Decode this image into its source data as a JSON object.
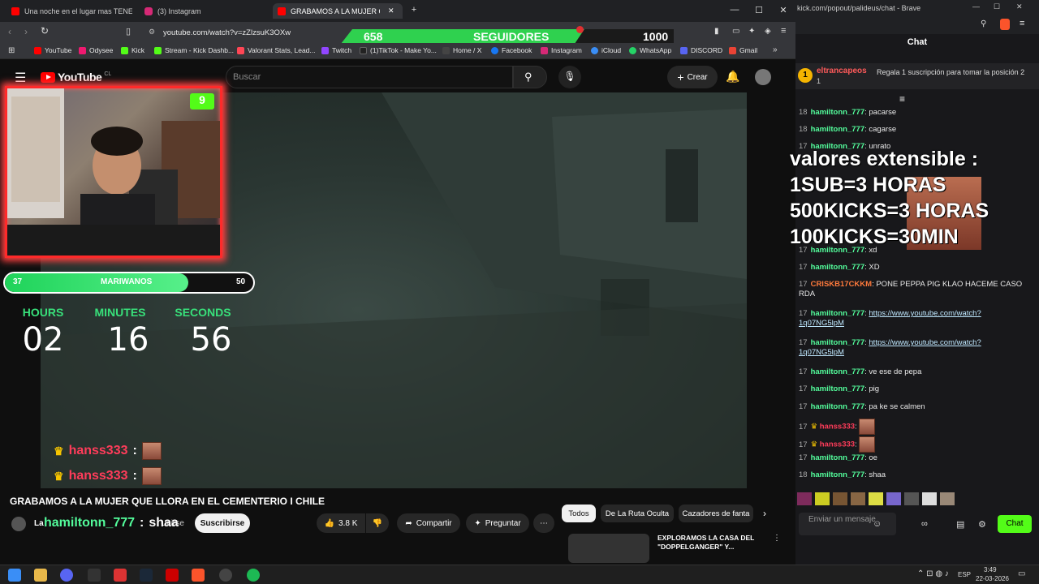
{
  "browser": {
    "tabs": [
      {
        "label": "Una noche en el lugar mas TENEBRO",
        "color": "#ff0000"
      },
      {
        "label": "(3) Instagram",
        "color": "#d62976"
      },
      {
        "label": "GRABAMOS A LA MUJER QU",
        "color": "#ff0000"
      }
    ],
    "url": "youtube.com/watch?v=zZlzsuK3OXw",
    "bookmarks": [
      {
        "label": "YouTube",
        "color": "#ff0000"
      },
      {
        "label": "Odysee",
        "color": "#ef1970"
      },
      {
        "label": "Kick",
        "color": "#53fc18"
      },
      {
        "label": "Stream - Kick Dashb...",
        "color": "#53fc18"
      },
      {
        "label": "Valorant Stats, Lead...",
        "color": "#ff4655"
      },
      {
        "label": "Twitch",
        "color": "#9146ff"
      },
      {
        "label": "(1)TikTok - Make Yo...",
        "color": "#222222"
      },
      {
        "label": "Home / X",
        "color": "#444444"
      },
      {
        "label": "Facebook",
        "color": "#1877f2"
      },
      {
        "label": "Instagram",
        "color": "#d62976"
      },
      {
        "label": "iCloud",
        "color": "#3a8ef6"
      },
      {
        "label": "WhatsApp",
        "color": "#25d366"
      },
      {
        "label": "DISCORD",
        "color": "#5865f2"
      },
      {
        "label": "Gmail",
        "color": "#ea4335"
      }
    ]
  },
  "followers": {
    "current": "658",
    "label": "SEGUIDORES",
    "goal": "1000"
  },
  "youtube": {
    "logo": "YouTube",
    "country": "CL",
    "search_placeholder": "Buscar",
    "create_label": "Crear"
  },
  "webcam_badge": "9",
  "goal_bar": {
    "current": "37",
    "label": "MARIWANOS",
    "max": "50",
    "fraction": 0.74
  },
  "timer": {
    "hours_label": "HOURS",
    "minutes_label": "MINUTES",
    "seconds_label": "SECONDS",
    "hours": "02",
    "minutes": "16",
    "seconds": "56"
  },
  "overlay_chat": [
    {
      "user": "hanss333",
      "sep": ":"
    },
    {
      "user": "hanss333",
      "sep": ":"
    },
    {
      "user": "hamiltonn_777",
      "sep": ":",
      "text": "shaa"
    }
  ],
  "video": {
    "title": "GRABAMOS A LA MUJER QUE LLORA EN EL CEMENTERIO I CHILE",
    "channel": "La",
    "join_label": "Unirse",
    "subscribe_label": "Suscribirse",
    "likes": "3.8 K",
    "share_label": "Compartir",
    "ask_label": "Preguntar"
  },
  "related": {
    "chips": [
      "Todos",
      "De La Ruta Oculta",
      "Cazadores de fanta"
    ],
    "first_title": "EXPLORAMOS LA CASA DEL \"DOPPELGANGER\" Y..."
  },
  "chatwin": {
    "url": "kick.com/popout/palideus/chat - Brave",
    "header": "Chat",
    "pinned_user": "eltrancapeos",
    "pinned_count": "1",
    "pinned_msg": "Regala 1 suscripción para tomar la posición 2",
    "input_placeholder": "Enviar un mensaje",
    "chat_button": "Chat",
    "messages": [
      {
        "n": "18",
        "user": "hamiltonn_777",
        "text": "pacarse",
        "kind": "u"
      },
      {
        "n": "18",
        "user": "hamiltonn_777",
        "text": "cagarse",
        "kind": "u"
      },
      {
        "n": "17",
        "user": "hamiltonn_777",
        "text": "unrato",
        "kind": "u"
      },
      {
        "n": "17",
        "user": "hamiltonn_777",
        "text": "xd",
        "kind": "u"
      },
      {
        "n": "17",
        "user": "hamiltonn_777",
        "text": "XD",
        "kind": "u"
      },
      {
        "n": "17",
        "user": "CRISKB17CKKM",
        "text": "PONE PEPPA PIG KLAO HACEME CASO",
        "text2": "RDA",
        "kind": "uo"
      },
      {
        "n": "17",
        "user": "hamiltonn_777",
        "text": "https://www.youtube.com/watch?",
        "text2": "1q07NG5lpM",
        "kind": "link"
      },
      {
        "n": "17",
        "user": "hamiltonn_777",
        "text": "https://www.youtube.com/watch?",
        "text2": "1q07NG5lpM",
        "kind": "link"
      },
      {
        "n": "17",
        "user": "hamiltonn_777",
        "text": "ve ese de pepa",
        "kind": "u"
      },
      {
        "n": "17",
        "user": "hamiltonn_777",
        "text": "pig",
        "kind": "u"
      },
      {
        "n": "17",
        "user": "hamiltonn_777",
        "text": "pa ke se calmen",
        "kind": "u"
      },
      {
        "n": "17",
        "user": "hanss333",
        "text": "",
        "kind": "uh"
      },
      {
        "n": "17",
        "user": "hanss333",
        "text": "",
        "kind": "uh"
      },
      {
        "n": "17",
        "user": "hamiltonn_777",
        "text": "oe",
        "kind": "u"
      },
      {
        "n": "18",
        "user": "hamiltonn_777",
        "text": "shaa",
        "kind": "u"
      }
    ],
    "overlay_lines": [
      "valores extensible :",
      "1SUB=3 HORAS",
      "500KICKS=3 HORAS",
      "100KICKS=30MIN"
    ]
  },
  "taskbar": {
    "lang": "ESP",
    "time": "3:49",
    "date": "22-03-2026"
  }
}
